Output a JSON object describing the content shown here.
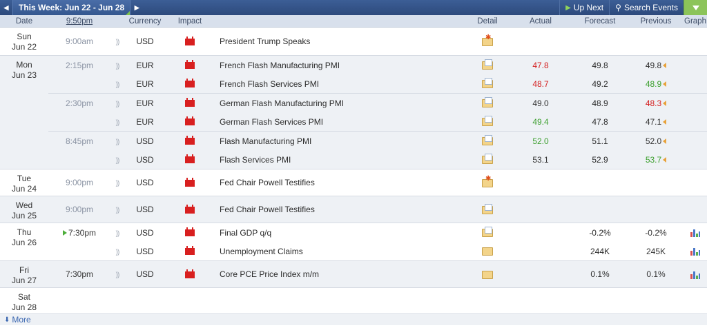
{
  "toolbar": {
    "prev_icon": "◀",
    "week_label": "This Week: Jun 22 - Jun 28",
    "next_icon": "▶",
    "up_next_label": "Up Next",
    "search_label": "Search Events"
  },
  "columns": {
    "date": "Date",
    "time": "9:50pm",
    "currency": "Currency",
    "impact": "Impact",
    "detail": "Detail",
    "actual": "Actual",
    "forecast": "Forecast",
    "previous": "Previous",
    "graph": "Graph"
  },
  "days": [
    {
      "dow": "Sun",
      "date": "Jun 22",
      "groups": [
        {
          "time": "9:00am",
          "rows": [
            {
              "currency": "USD",
              "event": "President Trump Speaks",
              "detail": "star",
              "actual": "",
              "actual_color": "",
              "forecast": "",
              "previous": "",
              "previous_color": "",
              "revised": false,
              "graph": false
            }
          ]
        }
      ]
    },
    {
      "dow": "Mon",
      "date": "Jun 23",
      "groups": [
        {
          "time": "2:15pm",
          "rows": [
            {
              "currency": "EUR",
              "event": "French Flash Manufacturing PMI",
              "detail": "doc",
              "actual": "47.8",
              "actual_color": "red",
              "forecast": "49.8",
              "previous": "49.8",
              "previous_color": "dark",
              "revised": true,
              "graph": false
            },
            {
              "currency": "EUR",
              "event": "French Flash Services PMI",
              "detail": "doc",
              "actual": "48.7",
              "actual_color": "red",
              "forecast": "49.2",
              "previous": "48.9",
              "previous_color": "green",
              "revised": true,
              "graph": false
            }
          ]
        },
        {
          "time": "2:30pm",
          "rows": [
            {
              "currency": "EUR",
              "event": "German Flash Manufacturing PMI",
              "detail": "doc",
              "actual": "49.0",
              "actual_color": "dark",
              "forecast": "48.9",
              "previous": "48.3",
              "previous_color": "red",
              "revised": true,
              "graph": false
            },
            {
              "currency": "EUR",
              "event": "German Flash Services PMI",
              "detail": "doc",
              "actual": "49.4",
              "actual_color": "green",
              "forecast": "47.8",
              "previous": "47.1",
              "previous_color": "dark",
              "revised": true,
              "graph": false
            }
          ]
        },
        {
          "time": "8:45pm",
          "rows": [
            {
              "currency": "USD",
              "event": "Flash Manufacturing PMI",
              "detail": "doc",
              "actual": "52.0",
              "actual_color": "green",
              "forecast": "51.1",
              "previous": "52.0",
              "previous_color": "dark",
              "revised": true,
              "graph": false
            },
            {
              "currency": "USD",
              "event": "Flash Services PMI",
              "detail": "doc",
              "actual": "53.1",
              "actual_color": "dark",
              "forecast": "52.9",
              "previous": "53.7",
              "previous_color": "green",
              "revised": true,
              "graph": false
            }
          ]
        }
      ]
    },
    {
      "dow": "Tue",
      "date": "Jun 24",
      "groups": [
        {
          "time": "9:00pm",
          "rows": [
            {
              "currency": "USD",
              "event": "Fed Chair Powell Testifies",
              "detail": "star",
              "actual": "",
              "actual_color": "",
              "forecast": "",
              "previous": "",
              "previous_color": "",
              "revised": false,
              "graph": false
            }
          ]
        }
      ]
    },
    {
      "dow": "Wed",
      "date": "Jun 25",
      "groups": [
        {
          "time": "9:00pm",
          "rows": [
            {
              "currency": "USD",
              "event": "Fed Chair Powell Testifies",
              "detail": "doc",
              "actual": "",
              "actual_color": "",
              "forecast": "",
              "previous": "",
              "previous_color": "",
              "revised": false,
              "graph": false
            }
          ]
        }
      ]
    },
    {
      "dow": "Thu",
      "date": "Jun 26",
      "groups": [
        {
          "time": "7:30pm",
          "live": true,
          "rows": [
            {
              "currency": "USD",
              "event": "Final GDP q/q",
              "detail": "doc",
              "actual": "",
              "actual_color": "",
              "forecast": "-0.2%",
              "previous": "-0.2%",
              "previous_color": "dark",
              "revised": false,
              "graph": true
            },
            {
              "currency": "USD",
              "event": "Unemployment Claims",
              "detail": "plain",
              "actual": "",
              "actual_color": "",
              "forecast": "244K",
              "previous": "245K",
              "previous_color": "dark",
              "revised": false,
              "graph": true
            }
          ]
        }
      ]
    },
    {
      "dow": "Fri",
      "date": "Jun 27",
      "groups": [
        {
          "time": "7:30pm",
          "time_dark": true,
          "rows": [
            {
              "currency": "USD",
              "event": "Core PCE Price Index m/m",
              "detail": "plain",
              "actual": "",
              "actual_color": "",
              "forecast": "0.1%",
              "previous": "0.1%",
              "previous_color": "dark",
              "revised": false,
              "graph": true
            }
          ]
        }
      ]
    },
    {
      "dow": "Sat",
      "date": "Jun 28",
      "groups": []
    }
  ],
  "footer": {
    "more_label": "More"
  },
  "colors": {
    "header_bg": "#2d4a7c",
    "column_header_bg": "#d8e0ec",
    "accent_green": "#8cc45a",
    "impact_high": "#d81f1f",
    "actual_bad": "#d42020",
    "actual_good": "#3c9f2e"
  }
}
